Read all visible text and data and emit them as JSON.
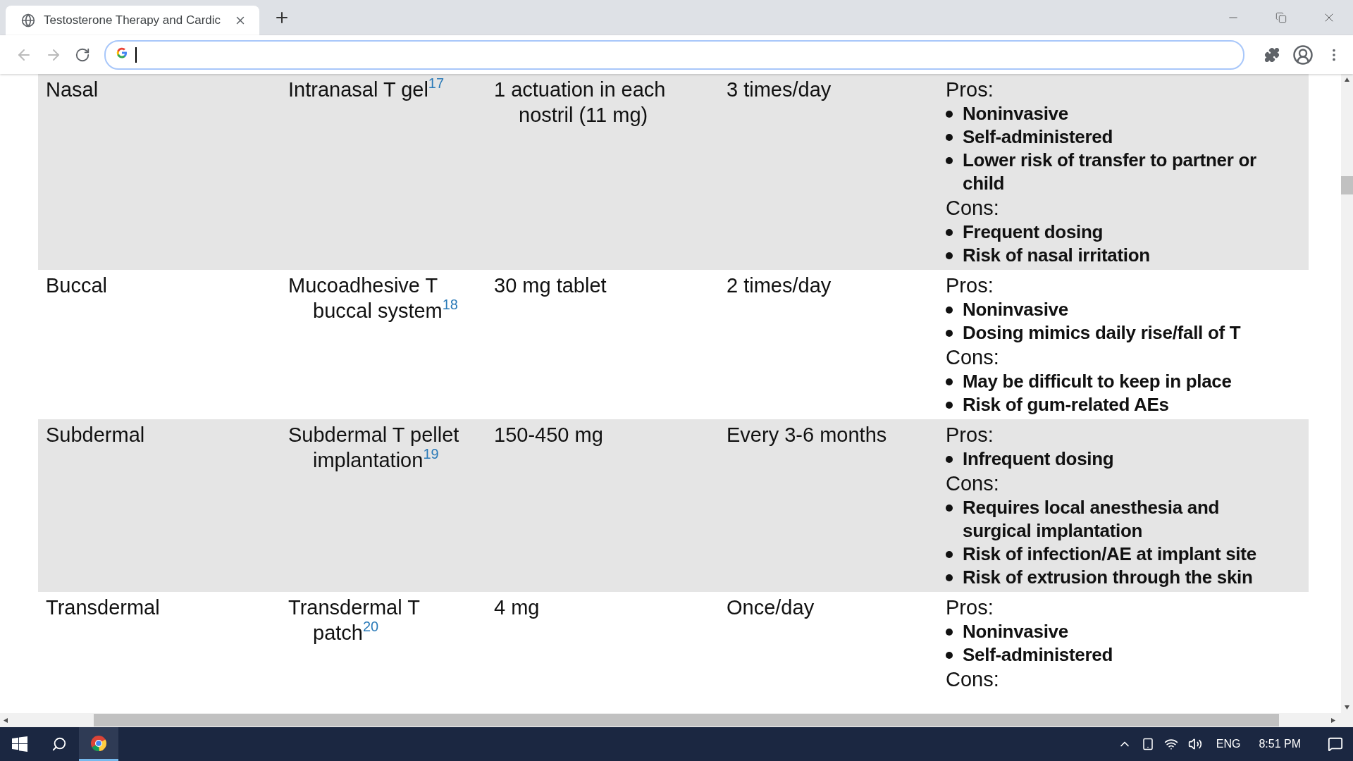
{
  "tab": {
    "title": "Testosterone Therapy and Cardic",
    "selected": true
  },
  "table": {
    "rows": [
      {
        "shaded": true,
        "route": "Nasal",
        "product": "Intranasal T gel$^{17}$",
        "dose": "1 actuation in each nostril (11 mg)",
        "frequency": "3 times/day",
        "pros_label": "Pros:",
        "pros": [
          "Noninvasive",
          "Self-administered",
          "Lower risk of transfer to partner or child"
        ],
        "cons_label": "Cons:",
        "cons": [
          "Frequent dosing",
          "Risk of nasal irritation"
        ]
      },
      {
        "shaded": false,
        "route": "Buccal",
        "product": "Mucoadhesive T buccal system$^{18}$",
        "dose": "30 mg tablet",
        "frequency": "2 times/day",
        "pros_label": "Pros:",
        "pros": [
          "Noninvasive",
          "Dosing mimics daily rise/fall of T"
        ],
        "cons_label": "Cons:",
        "cons": [
          "May be difficult to keep in place",
          "Risk of gum-related AEs"
        ]
      },
      {
        "shaded": true,
        "route": "Subdermal",
        "product": "Subdermal T pellet implantation$^{19}$",
        "dose": "150-450 mg",
        "frequency": "Every 3-6 months",
        "pros_label": "Pros:",
        "pros": [
          "Infrequent dosing"
        ],
        "cons_label": "Cons:",
        "cons": [
          "Requires local anesthesia and surgical implantation",
          "Risk of infection/AE at implant site",
          "Risk of extrusion through the skin"
        ]
      },
      {
        "shaded": false,
        "route": "Transdermal",
        "product": "Transdermal T patch$^{20}$",
        "dose": "4 mg",
        "frequency": "Once/day",
        "pros_label": "Pros:",
        "pros": [
          "Noninvasive",
          "Self-administered"
        ],
        "cons_label": "Cons:",
        "cons": []
      }
    ]
  },
  "taskbar": {
    "language": "ENG",
    "time": "8:51 PM"
  }
}
